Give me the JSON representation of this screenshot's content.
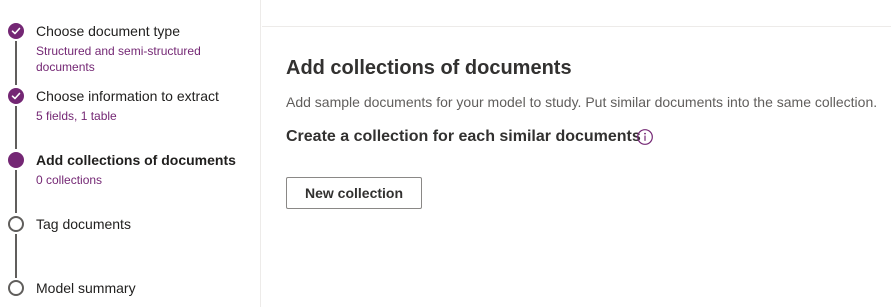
{
  "stepper": {
    "steps": [
      {
        "title": "Choose document type",
        "subtitle_line1": "Structured and semi-structured",
        "subtitle_line2": "documents",
        "state": "done"
      },
      {
        "title": "Choose information to extract",
        "subtitle": "5 fields, 1 table",
        "state": "done"
      },
      {
        "title": "Add collections of documents",
        "subtitle": "0 collections",
        "state": "current"
      },
      {
        "title": "Tag documents",
        "state": "pending"
      },
      {
        "title": "Model summary",
        "state": "pending"
      }
    ]
  },
  "main": {
    "title": "Add collections of documents",
    "description": "Add sample documents for your model to study. Put similar documents into the same collection.",
    "section_heading": "Create a collection for each similar documents",
    "info_icon": "info-icon",
    "new_collection_label": "New collection"
  },
  "colors": {
    "accent": "#742774",
    "text": "#201f1e",
    "secondary_text": "#605e5c",
    "border": "#8a8886"
  }
}
